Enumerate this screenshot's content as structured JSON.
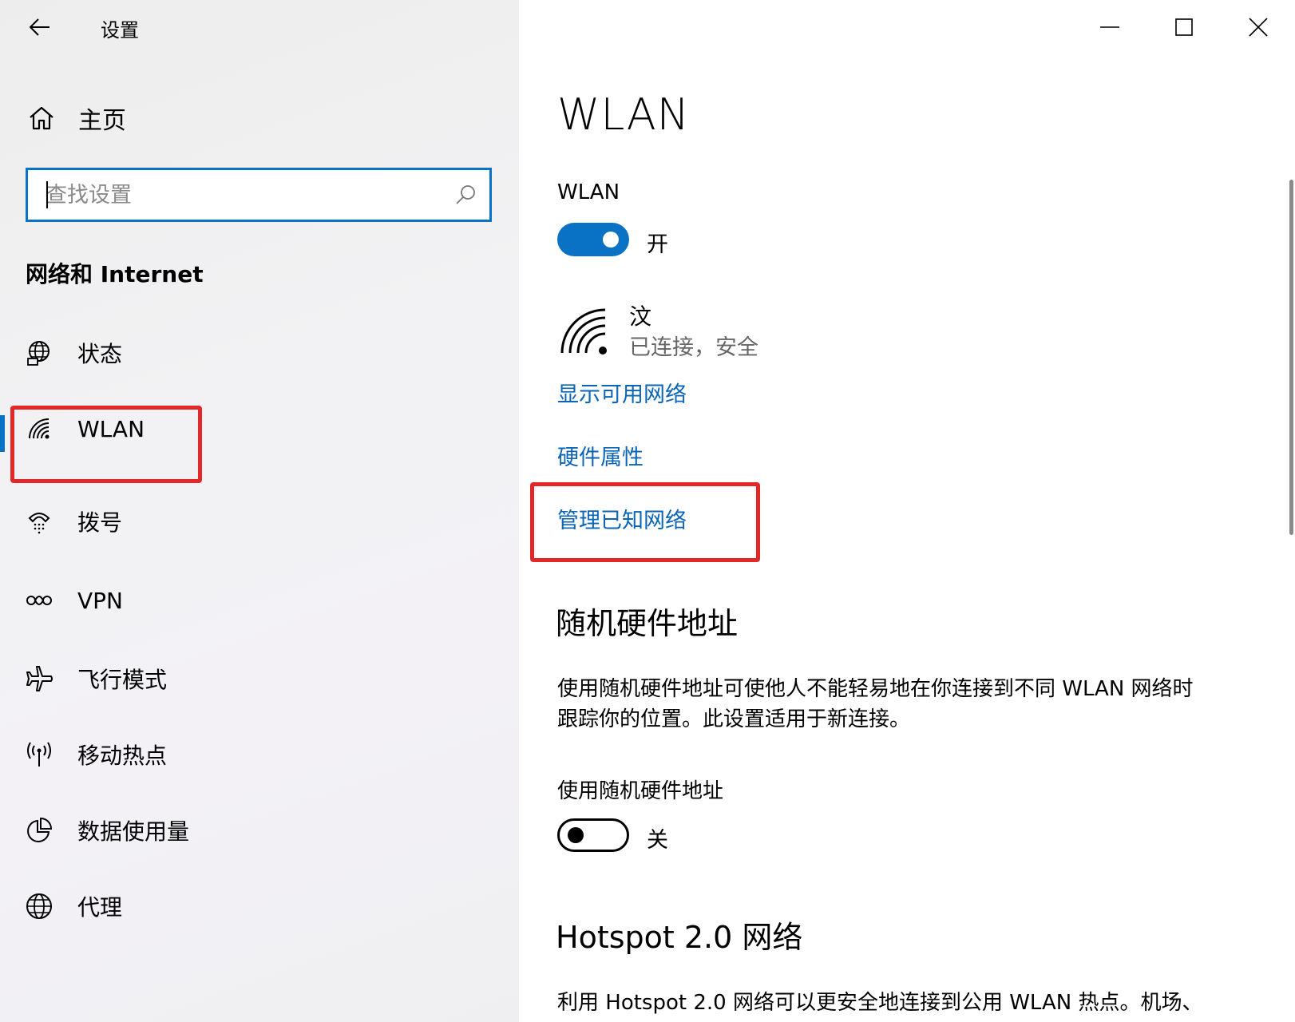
{
  "window": {
    "title": "设置"
  },
  "sidebar": {
    "home_label": "主页",
    "search": {
      "placeholder": "查找设置",
      "value": ""
    },
    "section_title": "网络和 Internet",
    "items": [
      {
        "label": "状态",
        "icon": "globe-status-icon"
      },
      {
        "label": "WLAN",
        "icon": "wifi-icon",
        "selected": true
      },
      {
        "label": "拨号",
        "icon": "dialup-icon"
      },
      {
        "label": "VPN",
        "icon": "vpn-icon"
      },
      {
        "label": "飞行模式",
        "icon": "airplane-icon"
      },
      {
        "label": "移动热点",
        "icon": "hotspot-icon"
      },
      {
        "label": "数据使用量",
        "icon": "data-usage-icon"
      },
      {
        "label": "代理",
        "icon": "globe-icon"
      }
    ]
  },
  "main": {
    "title": "WLAN",
    "wlan_label": "WLAN",
    "wlan_toggle": {
      "on": true,
      "state_text": "开"
    },
    "network": {
      "name": "汶",
      "status": "已连接，安全"
    },
    "links": {
      "show_available": "显示可用网络",
      "hardware_props": "硬件属性",
      "manage_known": "管理已知网络"
    },
    "random_mac": {
      "heading": "随机硬件地址",
      "description_line1": "使用随机硬件地址可使他人不能轻易地在你连接到不同 WLAN 网络时",
      "description_line2": "跟踪你的位置。此设置适用于新连接。",
      "toggle_label": "使用随机硬件地址",
      "toggle": {
        "on": false,
        "state_text": "关"
      }
    },
    "hotspot": {
      "heading": "Hotspot 2.0 网络",
      "description_line1": "利用 Hotspot 2.0 网络可以更安全地连接到公用 WLAN 热点。机场、"
    }
  },
  "colors": {
    "accent": "#0a72c4",
    "link": "#0a64b8",
    "highlight": "#e32727"
  }
}
